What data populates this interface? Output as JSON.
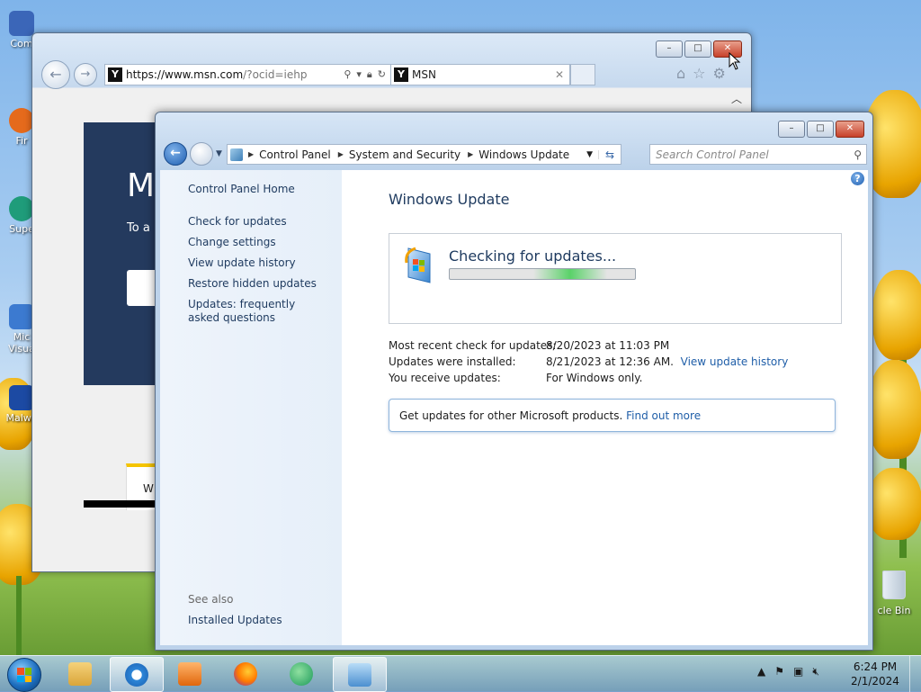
{
  "desktop": {
    "icons": [
      {
        "label": "Com",
        "color": "#3b66b8"
      },
      {
        "label": "Fir",
        "color": "#e56a1c"
      },
      {
        "label": "Supe",
        "color": "#1f9c7a"
      },
      {
        "label": "Mic Visua",
        "color": "#3c7ad0"
      },
      {
        "label": "Malwa",
        "color": "#1c4aa3"
      }
    ],
    "recycle_bin_label": "cle Bin"
  },
  "ie": {
    "url_prefix": "https://",
    "url_domain": "www.msn.com",
    "url_rest": "/?ocid=iehp",
    "tab_title": "MSN",
    "favicon_letter": "Y",
    "banner_big": "M",
    "banner_sub": "To a",
    "footer_text": "W"
  },
  "wu_window": {
    "breadcrumb": [
      "Control Panel",
      "System and Security",
      "Windows Update"
    ],
    "search_placeholder": "Search Control Panel",
    "sidebar": {
      "home": "Control Panel Home",
      "links": [
        "Check for updates",
        "Change settings",
        "View update history",
        "Restore hidden updates",
        "Updates: frequently asked questions"
      ],
      "see_also": "See also",
      "installed_updates": "Installed Updates"
    },
    "title": "Windows Update",
    "status": "Checking for updates...",
    "info": {
      "recent_check_label": "Most recent check for updates:",
      "recent_check_value": "8/20/2023 at 11:03 PM",
      "installed_label": "Updates were installed:",
      "installed_value": "8/21/2023 at 12:36 AM.",
      "history_link": "View update history",
      "receive_label": "You receive updates:",
      "receive_value": "For Windows only."
    },
    "promo": {
      "text": "Get updates for other Microsoft products.",
      "link": "Find out more"
    }
  },
  "taskbar": {
    "time": "6:24 PM",
    "date": "2/1/2024"
  }
}
